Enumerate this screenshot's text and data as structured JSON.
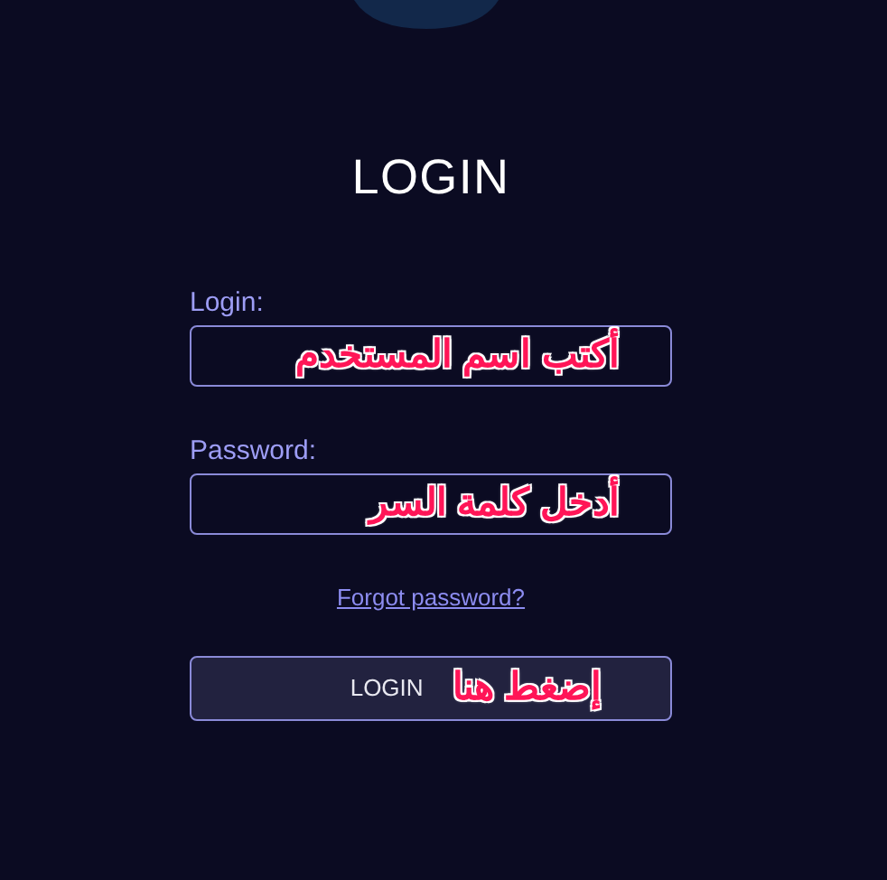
{
  "title": "LOGIN",
  "fields": [
    {
      "label": "Login:",
      "annotation": "أكتب اسم المستخدم"
    },
    {
      "label": "Password:",
      "annotation": "أدخل كلمة السر"
    }
  ],
  "forgot_link": "Forgot password?",
  "submit": {
    "label": "LOGIN",
    "annotation": "إضغط هنا"
  }
}
